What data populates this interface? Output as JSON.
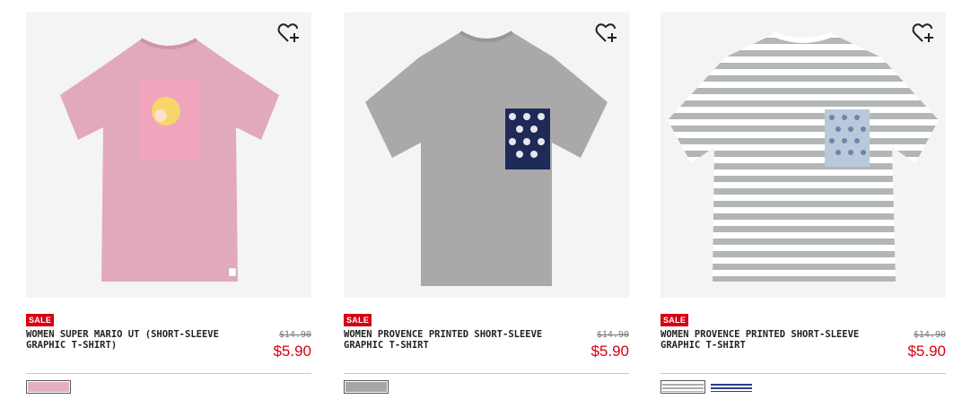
{
  "products": [
    {
      "badge": "SALE",
      "name": "WOMEN SUPER MARIO UT (SHORT-SLEEVE GRAPHIC T-SHIRT)",
      "original_price": "$14.90",
      "sale_price": "$5.90",
      "shirt_color": "#e2a9bd",
      "swatches": [
        "#e3b0c1"
      ]
    },
    {
      "badge": "SALE",
      "name": "WOMEN PROVENCE PRINTED SHORT-SLEEVE GRAPHIC T-SHIRT",
      "original_price": "$14.90",
      "sale_price": "$5.90",
      "shirt_color": "#a9a9a9",
      "swatches": [
        "#a6a6a6"
      ]
    },
    {
      "badge": "SALE",
      "name": "WOMEN PROVENCE PRINTED SHORT-SLEEVE GRAPHIC T-SHIRT",
      "original_price": "$14.90",
      "sale_price": "$5.90",
      "shirt_color": "#b9bcbd",
      "swatches": [
        "striped-gray",
        "striped-navy"
      ]
    }
  ],
  "colors": {
    "accent": "#d60011",
    "divider": "#c8c8c8"
  },
  "icons": {
    "favorite": "heart-plus-icon"
  }
}
